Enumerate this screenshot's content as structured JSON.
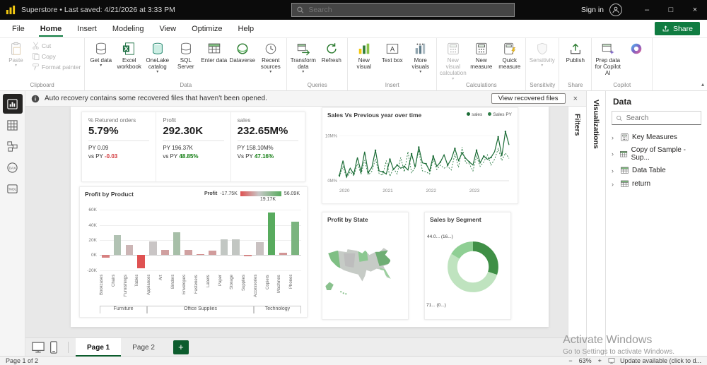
{
  "titlebar": {
    "title": "Superstore  •  Last saved: 4/21/2026 at 3:33 PM",
    "search_placeholder": "Search",
    "sign_in": "Sign in",
    "minimize": "–",
    "maximize": "□",
    "close": "×"
  },
  "menubar": {
    "items": [
      "File",
      "Home",
      "Insert",
      "Modeling",
      "View",
      "Optimize",
      "Help"
    ],
    "active_index": 1,
    "share_label": "Share"
  },
  "ribbon": {
    "collapse_icon": "▴",
    "groups": [
      {
        "name": "Clipboard",
        "items": [
          {
            "label": "Paste",
            "icon": "paste",
            "disabled": true,
            "caret": true
          },
          {
            "label": "Cut",
            "icon": "cut",
            "small": true,
            "disabled": true
          },
          {
            "label": "Copy",
            "icon": "copy",
            "small": true,
            "disabled": true
          },
          {
            "label": "Format painter",
            "icon": "brush",
            "small": true,
            "disabled": true
          }
        ]
      },
      {
        "name": "Data",
        "items": [
          {
            "label": "Get data",
            "icon": "db",
            "caret": true
          },
          {
            "label": "Excel workbook",
            "icon": "excel"
          },
          {
            "label": "OneLake catalog",
            "icon": "onelake",
            "caret": true
          },
          {
            "label": "SQL Server",
            "icon": "db"
          },
          {
            "label": "Enter data",
            "icon": "table"
          },
          {
            "label": "Dataverse",
            "icon": "dataverse"
          },
          {
            "label": "Recent sources",
            "icon": "recent",
            "caret": true
          }
        ]
      },
      {
        "name": "Queries",
        "items": [
          {
            "label": "Transform data",
            "icon": "transform",
            "caret": true
          },
          {
            "label": "Refresh",
            "icon": "refresh"
          }
        ]
      },
      {
        "name": "Insert",
        "items": [
          {
            "label": "New visual",
            "icon": "chart"
          },
          {
            "label": "Text box",
            "icon": "textbox"
          },
          {
            "label": "More visuals",
            "icon": "morevisuals",
            "caret": true
          }
        ]
      },
      {
        "name": "Calculations",
        "items": [
          {
            "label": "New visual calculation",
            "icon": "measure",
            "caret": true,
            "disabled": true
          },
          {
            "label": "New measure",
            "icon": "measure"
          },
          {
            "label": "Quick measure",
            "icon": "quickmeasure"
          }
        ]
      },
      {
        "name": "Sensitivity",
        "items": [
          {
            "label": "Sensitivity",
            "icon": "sensitivity",
            "caret": true,
            "disabled": true
          }
        ]
      },
      {
        "name": "Share",
        "items": [
          {
            "label": "Publish",
            "icon": "publish"
          }
        ]
      },
      {
        "name": "Copilot",
        "items": [
          {
            "label": "Prep data for Copilot AI",
            "icon": "prep"
          },
          {
            "label": "",
            "icon": "copilot"
          }
        ]
      }
    ]
  },
  "notification": {
    "text": "Auto recovery contains some recovered files that haven't been opened.",
    "action_label": "View recovered files",
    "close": "×"
  },
  "left_rail": {
    "items": [
      {
        "id": "report-view",
        "icon": "report",
        "active": true
      },
      {
        "id": "table-view",
        "icon": "grid",
        "active": false
      },
      {
        "id": "model-view",
        "icon": "model",
        "active": false
      },
      {
        "id": "dax-query-view",
        "icon": "dax",
        "active": false
      },
      {
        "id": "tmdl-view",
        "icon": "tmdl",
        "active": false
      }
    ]
  },
  "side_strips": {
    "filters": "Filters",
    "visualizations": "Visualizations"
  },
  "data_panel": {
    "title": "Data",
    "search_placeholder": "Search",
    "chevron": "›",
    "items": [
      {
        "label": "Key Measures",
        "icon": "measure"
      },
      {
        "label": "Copy of Sample - Sup...",
        "icon": "table"
      },
      {
        "label": "Data Table",
        "icon": "table"
      },
      {
        "label": "return",
        "icon": "table"
      }
    ]
  },
  "chart_data": [
    {
      "id": "kpi-cards",
      "type": "table",
      "cards": [
        {
          "label": "% Returend orders",
          "value": "5.79%",
          "py": "PY 0.09",
          "vs_prefix": "vs PY ",
          "vs_value": "-0.03",
          "vs_color": "#d13438"
        },
        {
          "label": "Profit",
          "value": "292.30K",
          "py": "PY 196.37K",
          "vs_prefix": "vs PY ",
          "vs_value": "48.85%",
          "vs_color": "#107c10"
        },
        {
          "label": "sales",
          "value": "232.65M%",
          "py": "PY 158.10M%",
          "vs_prefix": "Vs PY ",
          "vs_value": "47.16%",
          "vs_color": "#107c10"
        }
      ]
    },
    {
      "id": "sales-over-time",
      "type": "line",
      "title": "Sales Vs Previous year over time",
      "legend": [
        "sales",
        "Sales PY"
      ],
      "x_ticks": [
        "2020",
        "2021",
        "2022",
        "2023"
      ],
      "y_ticks": [
        "0M%",
        "10M%"
      ],
      "ylim": [
        0,
        12
      ],
      "series": [
        {
          "name": "sales",
          "style": "solid",
          "color": "#1a6b35",
          "values": [
            1.2,
            4.5,
            1.0,
            2.8,
            1.5,
            5.2,
            2.0,
            6.5,
            1.8,
            3.0,
            6.8,
            2.2,
            2.0,
            1.5,
            4.8,
            2.5,
            3.5,
            2.8,
            3.2,
            2.4,
            6.0,
            3.0,
            7.5,
            4.0,
            3.8,
            2.2,
            5.5,
            3.2,
            4.2,
            5.8,
            3.5,
            4.8,
            7.2,
            4.5,
            6.2,
            5.0,
            4.2,
            3.5,
            6.8,
            4.0,
            5.5,
            4.8,
            5.2,
            6.5,
            9.8,
            5.5,
            11.0,
            8.0
          ]
        },
        {
          "name": "Sales PY",
          "style": "dotted",
          "color": "#2d7d46",
          "values": [
            0.8,
            3.2,
            0.7,
            2.0,
            1.1,
            3.8,
            1.4,
            4.6,
            1.3,
            2.1,
            4.9,
            1.6,
            1.2,
            4.5,
            1.0,
            2.8,
            1.5,
            5.2,
            2.0,
            6.5,
            1.8,
            3.0,
            6.8,
            2.2,
            2.0,
            1.5,
            4.8,
            2.5,
            3.5,
            2.8,
            3.2,
            2.4,
            6.0,
            3.0,
            7.5,
            4.0,
            3.8,
            2.2,
            5.5,
            3.2,
            4.2,
            5.8,
            3.5,
            4.8,
            7.2,
            4.5,
            6.2,
            5.0
          ]
        }
      ]
    },
    {
      "id": "profit-by-product",
      "type": "bar",
      "title": "Profit by Product",
      "legend": {
        "label": "Profit",
        "min": "-17.75K",
        "mid": "19.17K",
        "max": "56.09K"
      },
      "ylim": [
        -24,
        62
      ],
      "y_ticks": [
        "-20K",
        "0K",
        "20K",
        "40K",
        "60K"
      ],
      "categories": [
        "Bookcases",
        "Chairs",
        "Furnishings",
        "Tables",
        "Appliances",
        "Art",
        "Binders",
        "Envelopes",
        "Fasteners",
        "Labels",
        "Paper",
        "Storage",
        "Supplies",
        "Accessories",
        "Copiers",
        "Machines",
        "Phones"
      ],
      "values": [
        -3.5,
        26.6,
        13.1,
        -17.7,
        18.1,
        6.5,
        30.2,
        6.9,
        0.9,
        5.5,
        21.0,
        21.3,
        -1.2,
        16.9,
        56.1,
        3.4,
        44.5
      ],
      "groups": [
        {
          "label": "Furniture",
          "span": 4
        },
        {
          "label": "Office Supplies",
          "span": 9
        },
        {
          "label": "Technology",
          "span": 4
        }
      ],
      "color_scale": {
        "min_color": "#df5252",
        "mid_color": "#c8c8c8",
        "max_color": "#58ab5e",
        "min": -17.75,
        "mid": 19.17,
        "max": 56.09
      }
    },
    {
      "id": "profit-by-state",
      "type": "map",
      "title": "Profit by State"
    },
    {
      "id": "sales-by-segment",
      "type": "donut",
      "title": "Sales by Segment",
      "segments": [
        {
          "label": "",
          "value": 30,
          "color": "#3f8f46"
        },
        {
          "label": "71... (0...)",
          "value": 53.5,
          "color": "#bfe3bf"
        },
        {
          "label": "44.0... (16...)",
          "value": 16.5,
          "color": "#8fcf94"
        }
      ]
    }
  ],
  "page_bar": {
    "tabs": [
      "Page 1",
      "Page 2"
    ],
    "active_index": 0,
    "new_page_label": "+"
  },
  "status_bar": {
    "page_info": "Page 1 of 2",
    "zoom_minus": "−",
    "zoom": "63%",
    "zoom_plus": "+",
    "update_text": "Update available (click to d..."
  },
  "watermark": {
    "line1": "Activate Windows",
    "line2": "Go to Settings to activate Windows."
  }
}
